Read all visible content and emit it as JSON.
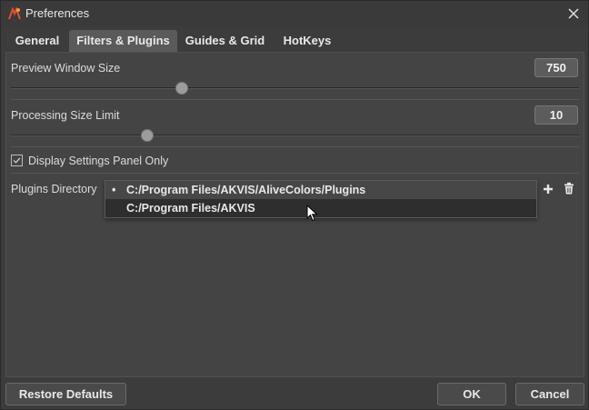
{
  "window": {
    "title": "Preferences",
    "app_icon": "akvis-app-icon",
    "close_icon": "close-icon"
  },
  "tabs": [
    {
      "label": "General",
      "active": false
    },
    {
      "label": "Filters & Plugins",
      "active": true
    },
    {
      "label": "Guides & Grid",
      "active": false
    },
    {
      "label": "HotKeys",
      "active": false
    }
  ],
  "preview_window_size": {
    "label": "Preview Window Size",
    "value": "750",
    "slider_fraction": 0.3
  },
  "processing_size_limit": {
    "label": "Processing Size Limit",
    "value": "10",
    "slider_fraction": 0.24
  },
  "display_settings_panel_only": {
    "label": "Display Settings Panel Only",
    "checked": true
  },
  "plugins_directory": {
    "label": "Plugins Directory",
    "items": [
      {
        "bullet": "•",
        "path": "C:/Program Files/AKVIS/AliveColors/Plugins",
        "selected": true
      },
      {
        "bullet": "",
        "path": "C:/Program Files/AKVIS",
        "hovered": true
      }
    ],
    "add_icon": "plus-icon",
    "delete_icon": "trash-icon"
  },
  "footer": {
    "restore_defaults": "Restore Defaults",
    "ok": "OK",
    "cancel": "Cancel"
  },
  "colors": {
    "background": "#3c3c3c",
    "panel": "#444444",
    "active_tab": "#5a5a5a",
    "hover_row": "#2e2e2e",
    "slider_handle": "#9c9c9c"
  }
}
